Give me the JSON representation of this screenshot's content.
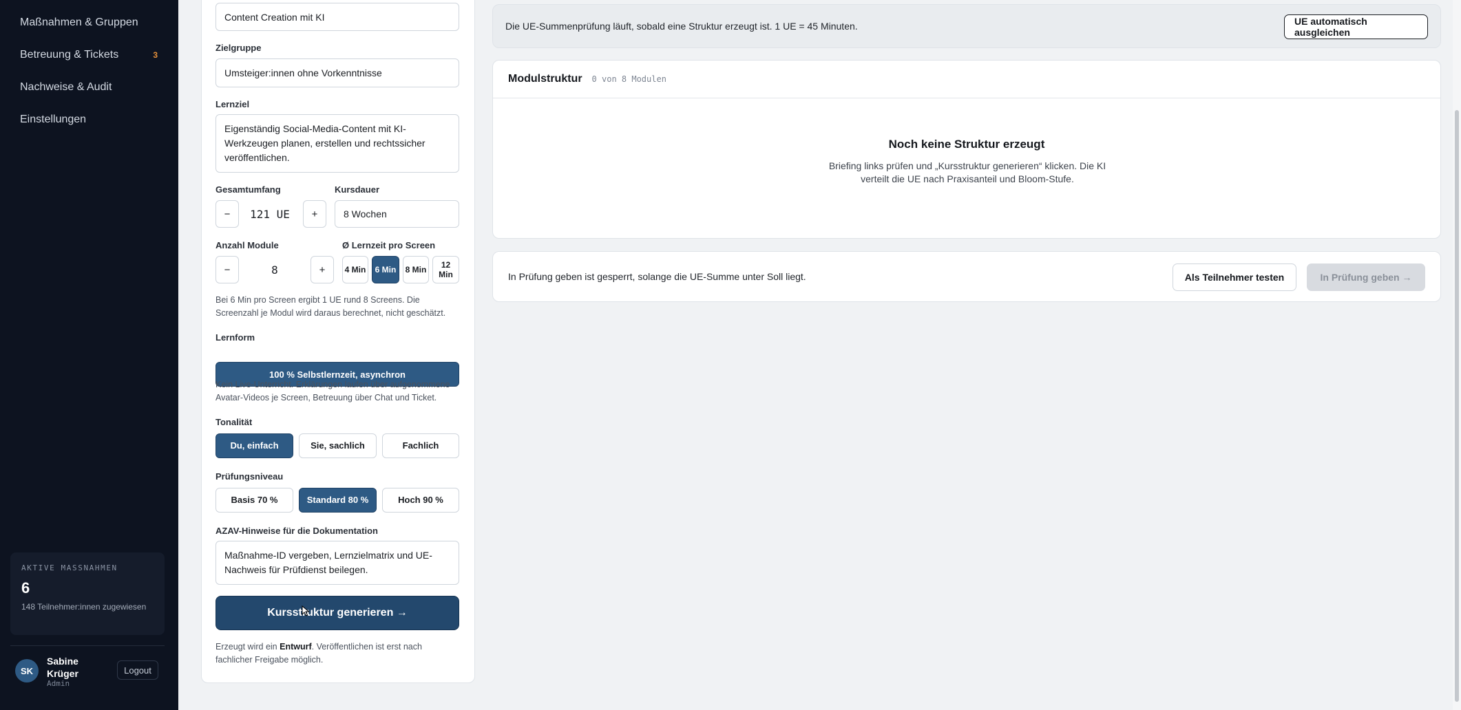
{
  "sidebar": {
    "nav": [
      {
        "label": "Maßnahmen & Gruppen",
        "badge": ""
      },
      {
        "label": "Betreuung & Tickets",
        "badge": "3"
      },
      {
        "label": "Nachweise & Audit",
        "badge": ""
      },
      {
        "label": "Einstellungen",
        "badge": ""
      }
    ],
    "stat": {
      "label": "AKTIVE MASSNAHMEN",
      "value": "6",
      "sub": "148 Teilnehmer:innen zugewiesen"
    },
    "user": {
      "initials": "SK",
      "name": "Sabine Krüger",
      "role": "Admin",
      "logout": "Logout"
    }
  },
  "form": {
    "title_value": "Content Creation mit KI",
    "audience_label": "Zielgruppe",
    "audience_value": "Umsteiger:innen ohne Vorkenntnisse",
    "goal_label": "Lernziel",
    "goal_value": "Eigenständig Social-Media-Content mit KI-Werkzeugen planen, erstellen und rechtssicher veröffentlichen.",
    "total_label": "Gesamtumfang",
    "total_value": "121 UE",
    "duration_label": "Kursdauer",
    "duration_value": "8 Wochen",
    "modules_label": "Anzahl Module",
    "modules_value": "8",
    "minus": "−",
    "plus": "+",
    "screen_time_label": "Ø Lernzeit pro Screen",
    "screen_time_options": [
      "4 Min",
      "6 Min",
      "8 Min",
      "12 Min"
    ],
    "screen_time_selected": "6 Min",
    "screen_hint": "Bei 6 Min pro Screen ergibt 1 UE rund 8 Screens. Die Screenzahl je Modul wird daraus berechnet, nicht geschätzt.",
    "learnform_label": "Lernform",
    "learnform_value": "100 % Selbstlernzeit, asynchron",
    "learnform_hint": "Kein Live-Unterricht. Erklärungen laufen über aufgenommene Avatar-Videos je Screen, Betreuung über Chat und Ticket.",
    "tone_label": "Tonalität",
    "tone_options": [
      "Du, einfach",
      "Sie, sachlich",
      "Fachlich"
    ],
    "tone_selected": "Du, einfach",
    "exam_label": "Prüfungsniveau",
    "exam_options": [
      "Basis 70 %",
      "Standard 80 %",
      "Hoch 90 %"
    ],
    "exam_selected": "Standard 80 %",
    "azav_label": "AZAV-Hinweise für die Dokumentation",
    "azav_value": "Maßnahme-ID vergeben, Lernzielmatrix und UE-Nachweis für Prüfdienst beilegen.",
    "generate_label": "Kursstruktur generieren →",
    "footer_prefix": "Erzeugt wird ein ",
    "footer_bold": "Entwurf",
    "footer_suffix": ". Veröffentlichen ist erst nach fachlicher Freigabe möglich."
  },
  "main": {
    "notice_text": "Die UE-Summenprüfung läuft, sobald eine Struktur erzeugt ist. 1 UE = 45 Minuten.",
    "auto_balance": "UE automatisch ausgleichen",
    "structure_title": "Modulstruktur",
    "structure_count": "0 von 8 Modulen",
    "empty_title": "Noch keine Struktur erzeugt",
    "empty_text": "Briefing links prüfen und „Kursstruktur generieren“ klicken. Die KI verteilt die UE nach Praxisanteil und Bloom-Stufe.",
    "review_text": "In Prüfung geben ist gesperrt, solange die UE-Summe unter Soll liegt.",
    "test_button": "Als Teilnehmer testen",
    "review_button": "In Prüfung geben →"
  }
}
